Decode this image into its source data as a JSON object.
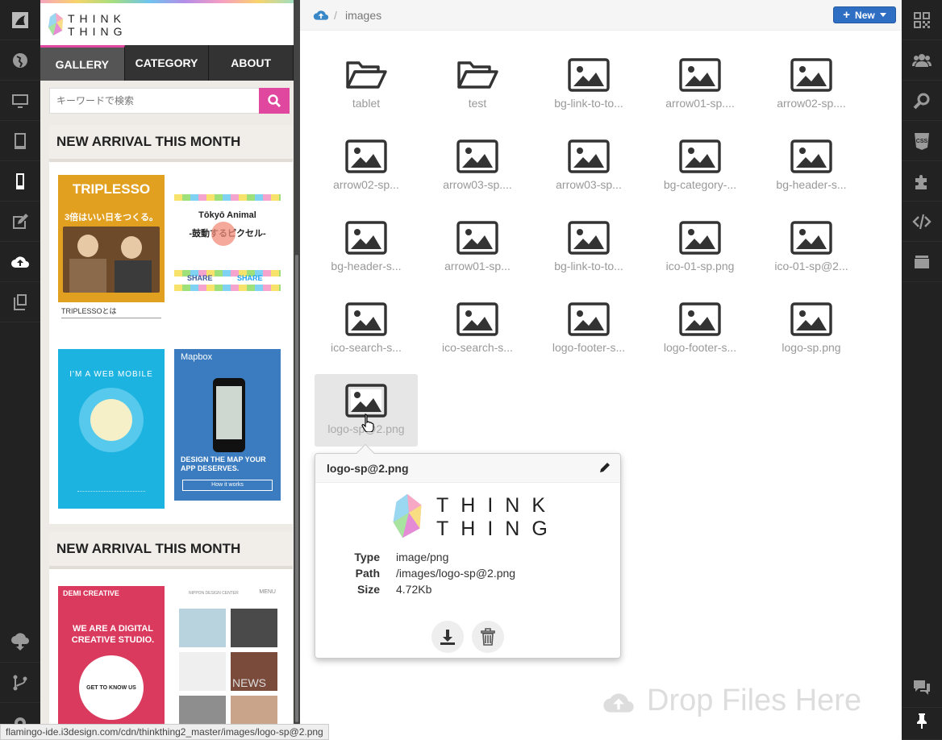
{
  "breadcrumb": {
    "folder": "images",
    "separator": "/"
  },
  "toolbar": {
    "new_label": "New"
  },
  "files": [
    {
      "name": "tablet",
      "kind": "folder"
    },
    {
      "name": "test",
      "kind": "folder"
    },
    {
      "name": "bg-link-to-to...",
      "kind": "image"
    },
    {
      "name": "arrow01-sp....",
      "kind": "image"
    },
    {
      "name": "arrow02-sp....",
      "kind": "image"
    },
    {
      "name": "arrow02-sp...",
      "kind": "image"
    },
    {
      "name": "arrow03-sp....",
      "kind": "image"
    },
    {
      "name": "arrow03-sp...",
      "kind": "image"
    },
    {
      "name": "bg-category-...",
      "kind": "image"
    },
    {
      "name": "bg-header-s...",
      "kind": "image"
    },
    {
      "name": "bg-header-s...",
      "kind": "image"
    },
    {
      "name": "arrow01-sp...",
      "kind": "image"
    },
    {
      "name": "bg-link-to-to...",
      "kind": "image"
    },
    {
      "name": "ico-01-sp.png",
      "kind": "image"
    },
    {
      "name": "ico-01-sp@2...",
      "kind": "image"
    },
    {
      "name": "ico-search-s...",
      "kind": "image"
    },
    {
      "name": "ico-search-s...",
      "kind": "image"
    },
    {
      "name": "logo-footer-s...",
      "kind": "image"
    },
    {
      "name": "logo-footer-s...",
      "kind": "image"
    },
    {
      "name": "logo-sp.png",
      "kind": "image"
    },
    {
      "name": "logo-sp@2.png",
      "kind": "image",
      "selected": true
    }
  ],
  "popover": {
    "title": "logo-sp@2.png",
    "preview_logo_line1": "THINK",
    "preview_logo_line2": "THING",
    "type_label": "Type",
    "type_value": "image/png",
    "path_label": "Path",
    "path_value": "/images/logo-sp@2.png",
    "size_label": "Size",
    "size_value": "4.72Kb"
  },
  "drop_zone": {
    "label": "Drop Files Here"
  },
  "preview_site": {
    "logo_line1": "THINK",
    "logo_line2": "THING",
    "nav": [
      "GALLERY",
      "CATEGORY",
      "ABOUT"
    ],
    "search_placeholder": "キーワードで検索",
    "section_heading": "NEW ARRIVAL THIS MONTH",
    "card1_title": "TRIPLESSO",
    "card1_sub": "3倍はいい日をつくる。",
    "card1_footer": "TRIPLESSOとは",
    "card2_title": "Tōkyō Animal",
    "card2_sub": "-鼓動するピクセル-",
    "card2_share1": "SHARE",
    "card2_share2": "SHARE",
    "card3_title": "I'M A WEB MOBILE",
    "card4_title": "Mapbox",
    "card4_tagline": "DESIGN THE MAP YOUR APP DESERVES.",
    "card4_button": "How it works",
    "card5_brand": "DEMI CREATIVE",
    "card5_tagline": "WE ARE A DIGITAL CREATIVE STUDIO.",
    "card5_button": "GET TO KNOW US",
    "card6_title": "NIPPON DESIGN CENTER",
    "card6_menu": "MENU",
    "card6_news": "NEWS"
  },
  "status_bar": {
    "url": "flamingo-ide.i3design.com/cdn/thinkthing2_master/images/logo-sp@2.png"
  },
  "colors": {
    "accent_blue": "#2e6fc4",
    "pink": "#e0479e",
    "rail": "#222222"
  }
}
